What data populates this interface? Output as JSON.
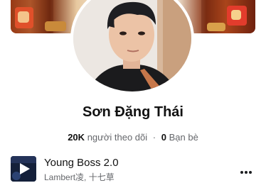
{
  "profile": {
    "name": "Sơn Đặng Thái",
    "followers_count": "20K",
    "followers_label": "người theo dõi",
    "separator": "·",
    "friends_count": "0",
    "friends_label": "Bạn bè"
  },
  "music": {
    "title": "Young Boss 2.0",
    "artist": "Lambert凌, 十七草"
  },
  "icons": {
    "more": "more-horizontal-icon",
    "play": "play-icon"
  }
}
